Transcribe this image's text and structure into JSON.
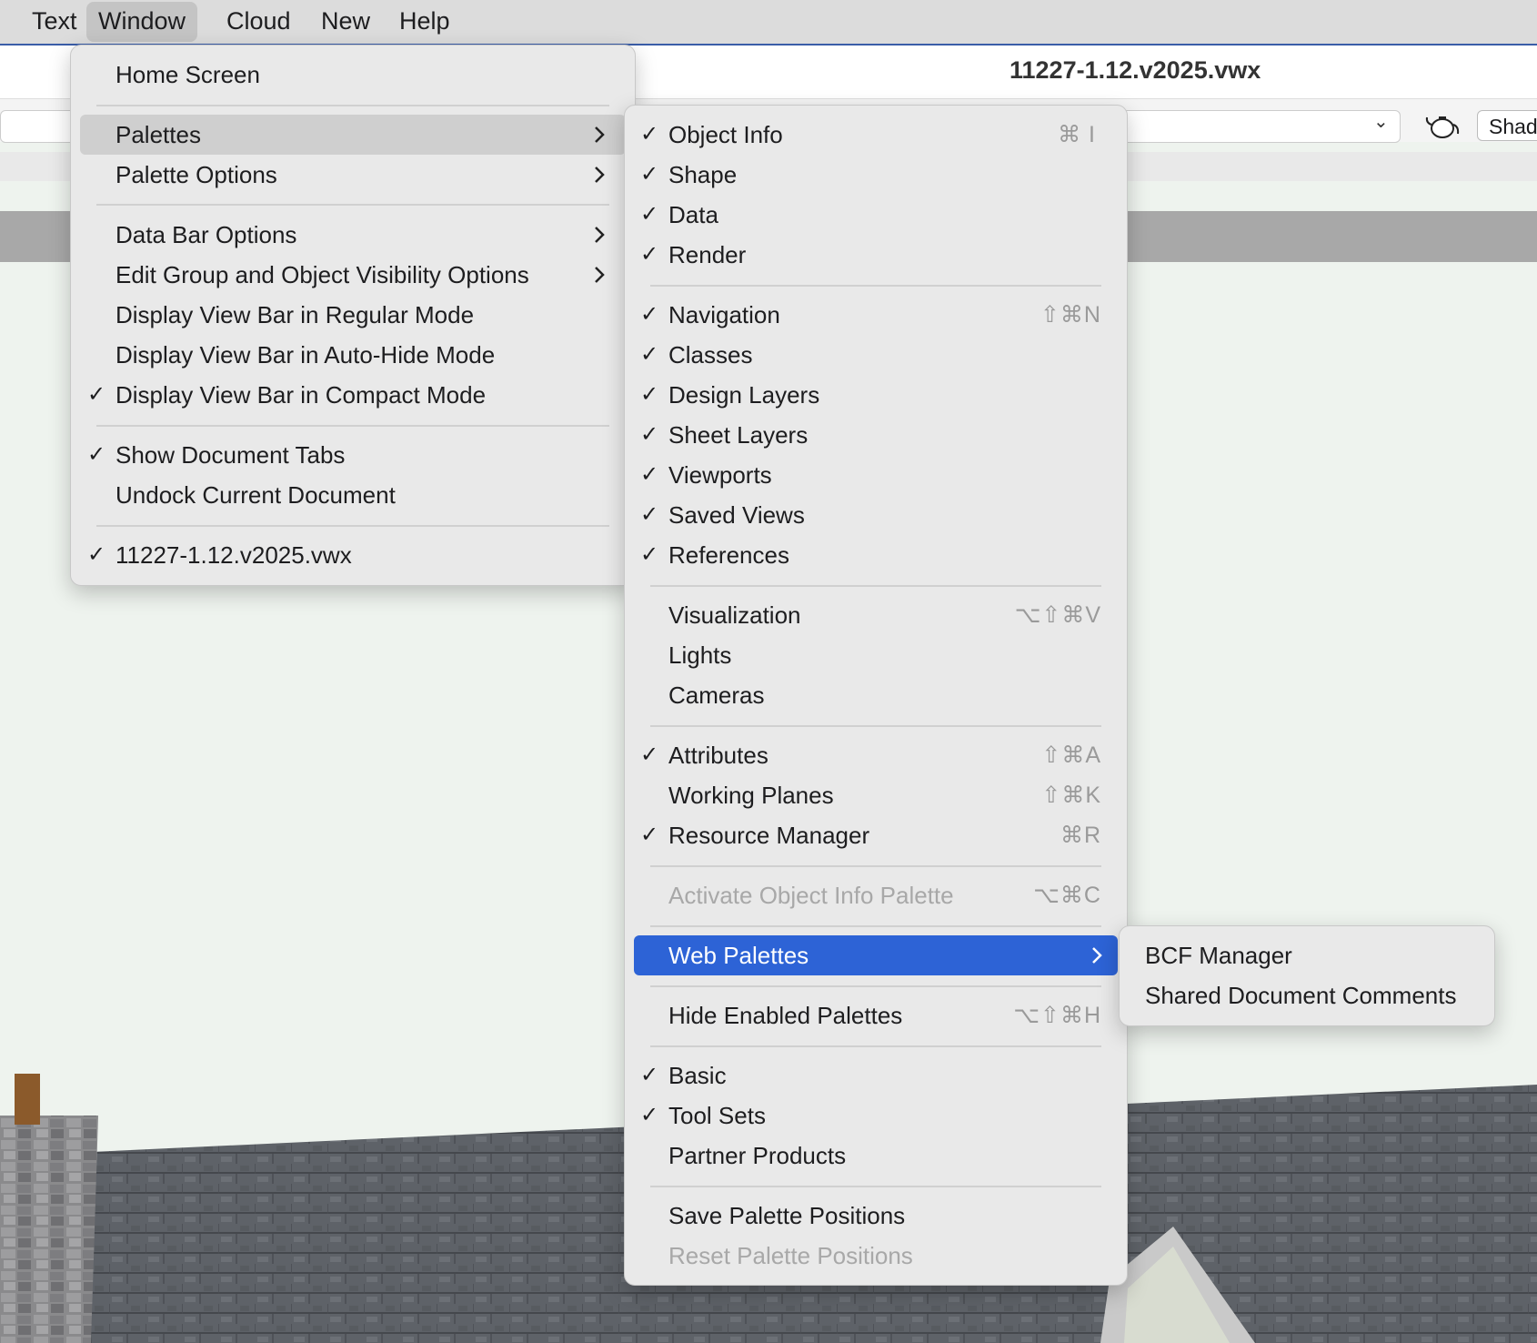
{
  "menubar": {
    "items": [
      {
        "label": "Text"
      },
      {
        "label": "Window"
      },
      {
        "label": "Cloud"
      },
      {
        "label": "New"
      },
      {
        "label": "Help"
      }
    ]
  },
  "document": {
    "title": "11227-1.12.v2025.vwx"
  },
  "toolbar": {
    "shad_button": "Shad",
    "render_icon": "teapot-icon"
  },
  "window_menu": {
    "home_screen": "Home Screen",
    "palettes": "Palettes",
    "palette_options": "Palette Options",
    "data_bar_options": "Data Bar Options",
    "edit_group_visibility": "Edit Group and Object Visibility Options",
    "view_bar_regular": "Display View Bar in Regular Mode",
    "view_bar_autohide": "Display View Bar in Auto-Hide Mode",
    "view_bar_compact": "Display View Bar in Compact Mode",
    "show_document_tabs": "Show Document Tabs",
    "undock_current": "Undock Current Document",
    "current_doc": "11227-1.12.v2025.vwx"
  },
  "palettes_menu": {
    "object_info": "Object Info",
    "object_info_sc": "⌘ I",
    "shape": "Shape",
    "data": "Data",
    "render": "Render",
    "navigation": "Navigation",
    "navigation_sc": "⇧⌘N",
    "classes": "Classes",
    "design_layers": "Design Layers",
    "sheet_layers": "Sheet Layers",
    "viewports": "Viewports",
    "saved_views": "Saved Views",
    "references": "References",
    "visualization": "Visualization",
    "visualization_sc": "⌥⇧⌘V",
    "lights": "Lights",
    "cameras": "Cameras",
    "attributes": "Attributes",
    "attributes_sc": "⇧⌘A",
    "working_planes": "Working Planes",
    "working_planes_sc": "⇧⌘K",
    "resource_manager": "Resource Manager",
    "resource_manager_sc": "⌘R",
    "activate_oip": "Activate Object Info Palette",
    "activate_oip_sc": "⌥⌘C",
    "web_palettes": "Web Palettes",
    "hide_enabled": "Hide Enabled Palettes",
    "hide_enabled_sc": "⌥⇧⌘H",
    "basic": "Basic",
    "tool_sets": "Tool Sets",
    "partner_products": "Partner Products",
    "save_positions": "Save Palette Positions",
    "reset_positions": "Reset Palette Positions"
  },
  "web_palettes_menu": {
    "bcf_manager": "BCF Manager",
    "shared_comments": "Shared Document Comments"
  },
  "colors": {
    "selection": "#2d63d6",
    "menu_bg": "#e9e9e9"
  }
}
